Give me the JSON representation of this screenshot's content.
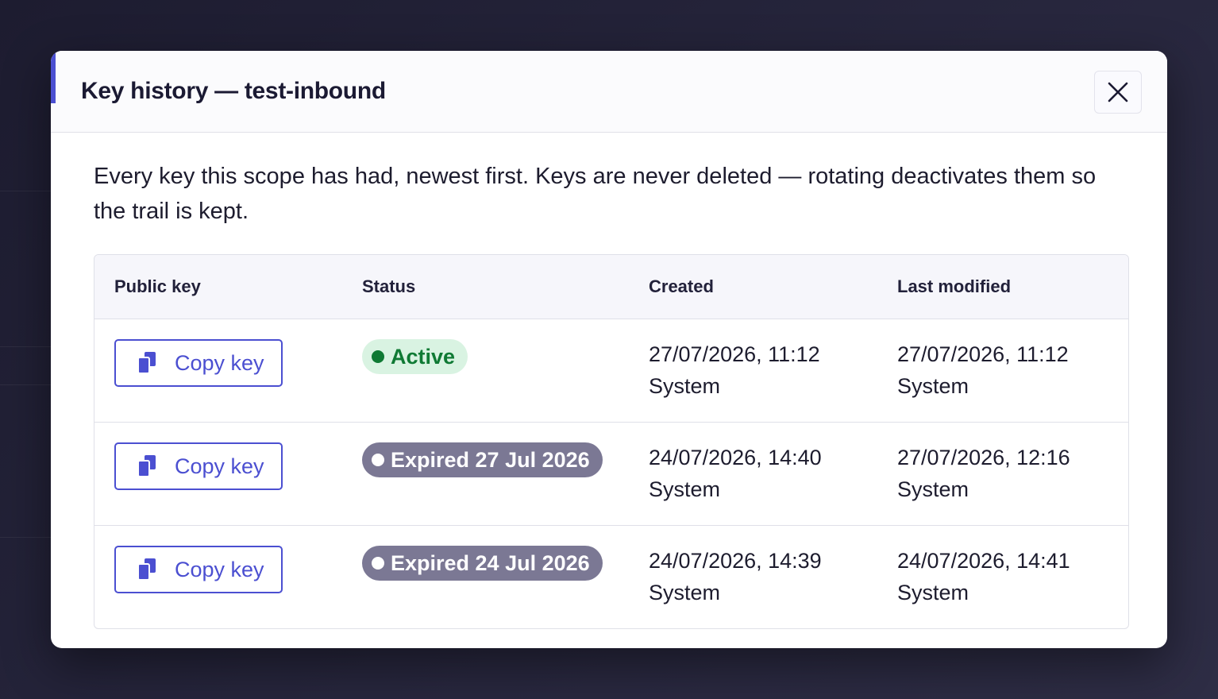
{
  "modal": {
    "title": "Key history — test-inbound",
    "description": "Every key this scope has had, newest first. Keys are never deleted — rotating deactivates them so the trail is kept.",
    "close_icon": "close-icon"
  },
  "table": {
    "headers": [
      "Public key",
      "Status",
      "Created",
      "Last modified"
    ],
    "rows": [
      {
        "copy_label": "Copy key",
        "status": "Active",
        "status_kind": "active",
        "created_date": "27/07/2026, 11:12",
        "created_by": "System",
        "modified_date": "27/07/2026, 11:12",
        "modified_by": "System"
      },
      {
        "copy_label": "Copy key",
        "status": "Expired 27 Jul 2026",
        "status_kind": "expired",
        "created_date": "24/07/2026, 14:40",
        "created_by": "System",
        "modified_date": "27/07/2026, 12:16",
        "modified_by": "System"
      },
      {
        "copy_label": "Copy key",
        "status": "Expired 24 Jul 2026",
        "status_kind": "expired",
        "created_date": "24/07/2026, 14:39",
        "created_by": "System",
        "modified_date": "24/07/2026, 14:41",
        "modified_by": "System"
      }
    ]
  },
  "colors": {
    "accent": "#4b4fd1",
    "active_bg": "#d9f3e2",
    "active_text": "#0f7a34",
    "expired_bg": "#7b7894"
  }
}
